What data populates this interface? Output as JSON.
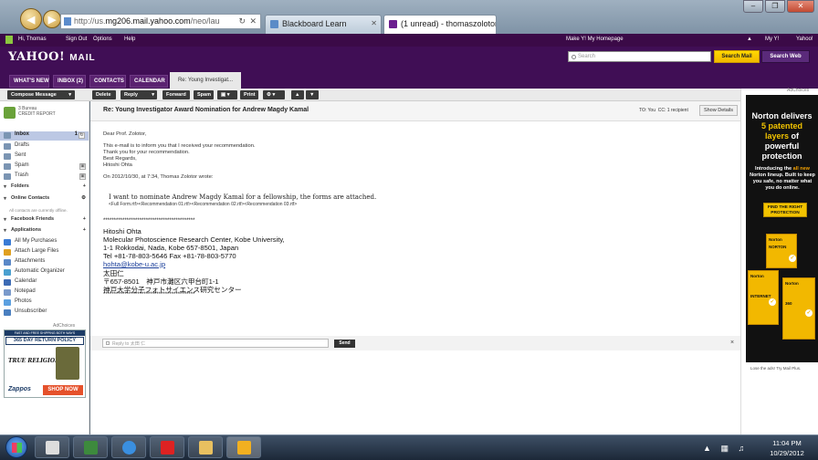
{
  "browser": {
    "url_prefix": "http://us.",
    "url_host": "mg206.mail.yahoo.com",
    "url_suffix": "/neo/lau",
    "tabs": [
      {
        "label": "Blackboard Learn"
      },
      {
        "label": "(1 unread) - thomaszolotor"
      }
    ],
    "colors": {
      "tab_bb": "#5b8bc7",
      "tab_yahoo": "#6b1e8f"
    }
  },
  "yahoo_bar": {
    "greeting": "Hi, Thomas",
    "sign_out": "Sign Out",
    "options": "Options",
    "help": "Help",
    "make_homepage": "Make Y! My Homepage",
    "my_y": "My Y!",
    "yahoo": "Yahoo!"
  },
  "header": {
    "logo": "YAHOO!",
    "logo_sub": "MAIL",
    "search_placeholder": "Search",
    "search_mail": "Search Mail",
    "search_web": "Search Web"
  },
  "nav_tabs": [
    {
      "label": "WHAT'S NEW"
    },
    {
      "label": "INBOX (2)"
    },
    {
      "label": "CONTACTS"
    },
    {
      "label": "CALENDAR"
    },
    {
      "label": "Re: Young Investigat..."
    }
  ],
  "toolbar": {
    "compose": "Compose Message",
    "delete": "Delete",
    "reply": "Reply",
    "forward": "Forward",
    "spam": "Spam",
    "print": "Print"
  },
  "sidebar": {
    "credit_title": "3 Bureau",
    "credit_sub": "CREDIT REPORT",
    "folders": [
      {
        "label": "Inbox",
        "count": "1"
      },
      {
        "label": "Drafts"
      },
      {
        "label": "Sent"
      },
      {
        "label": "Spam"
      },
      {
        "label": "Trash"
      }
    ],
    "folders_head": "Folders",
    "online_head": "Online Contacts",
    "online_note": "All contacts are currently offline.",
    "facebook_head": "Facebook Friends",
    "apps_head": "Applications",
    "apps": [
      {
        "label": "All My Purchases"
      },
      {
        "label": "Attach Large Files"
      },
      {
        "label": "Attachments"
      },
      {
        "label": "Automatic Organizer"
      },
      {
        "label": "Calendar"
      },
      {
        "label": "Notepad"
      },
      {
        "label": "Photos"
      },
      {
        "label": "Unsubscriber"
      }
    ],
    "adchoices": "AdChoices"
  },
  "zappos_ad": {
    "top": "FAST AND FREE SHIPPING BOTH WAYS",
    "return": "365 DAY RETURN POLICY",
    "brand": "TRUE RELIGION",
    "logo": "Zappos",
    "shop": "SHOP NOW"
  },
  "message": {
    "subject": "Re: Young Investigator Award Nomination for Andrew Magdy Kamal",
    "to": "TO: You",
    "cc": "CC: 1 recipient",
    "show_details": "Show Details",
    "greeting": "Dear Prof. Zolotor,",
    "body": [
      "This e-mail is to inform you that I received your recommendation.",
      "Thank you for your recommendation.",
      "Best Regards,",
      "Hitoshi Ohta"
    ],
    "wrote": "On 2012/10/30, at 7:34, Thomas Zolotor wrote:",
    "quote_main": "I want to nominate Andrew Magdy Kamal for a fellowship, the forms are attached.",
    "quote_files": "<Full Form.rtf><Recommendation 01.rtf><Recommendation 02.rtf><Recommendation 03.rtf>",
    "signature": [
      "*******************************************",
      "Hitoshi Ohta",
      "Molecular Photoscience Research Center, Kobe University,",
      "1-1 Rokkodai, Nada, Kobe 657-8501, Japan",
      "Tel  +81-78-803-5646    Fax  +81-78-803-5770",
      "hohta@kobe-u.ac.jp",
      "太田仁",
      "〒657-8501　神戸市灘区六甲台町1-1",
      "神戸大学分子フォトサイエンス研究センター",
      "*******************************************"
    ]
  },
  "reply": {
    "placeholder": "Reply to 太田 仁",
    "send": "Send",
    "close": "×"
  },
  "norton_ad": {
    "adchoices": "AdChoices",
    "line1": "Norton delivers",
    "line2_hl": "5 patented",
    "line3_hl": "layers",
    "line3": " of",
    "line4": "powerful",
    "line5": "protection",
    "p1": "Introducing the ",
    "p_hl": "all new",
    "p2": " Norton lineup. Built to keep you safe, no matter what you do online.",
    "cta": "FIND THE RIGHT PROTECTION",
    "boxes": [
      {
        "label": "Norton"
      },
      {
        "label": "Norton"
      },
      {
        "label": "Norton"
      }
    ],
    "box_subs": [
      "NORTON",
      "INTERNET",
      "360"
    ],
    "footer": "Lose the ads! Try Mail Plus."
  },
  "taskbar": {
    "time": "11:04 PM",
    "date": "10/29/2012"
  }
}
